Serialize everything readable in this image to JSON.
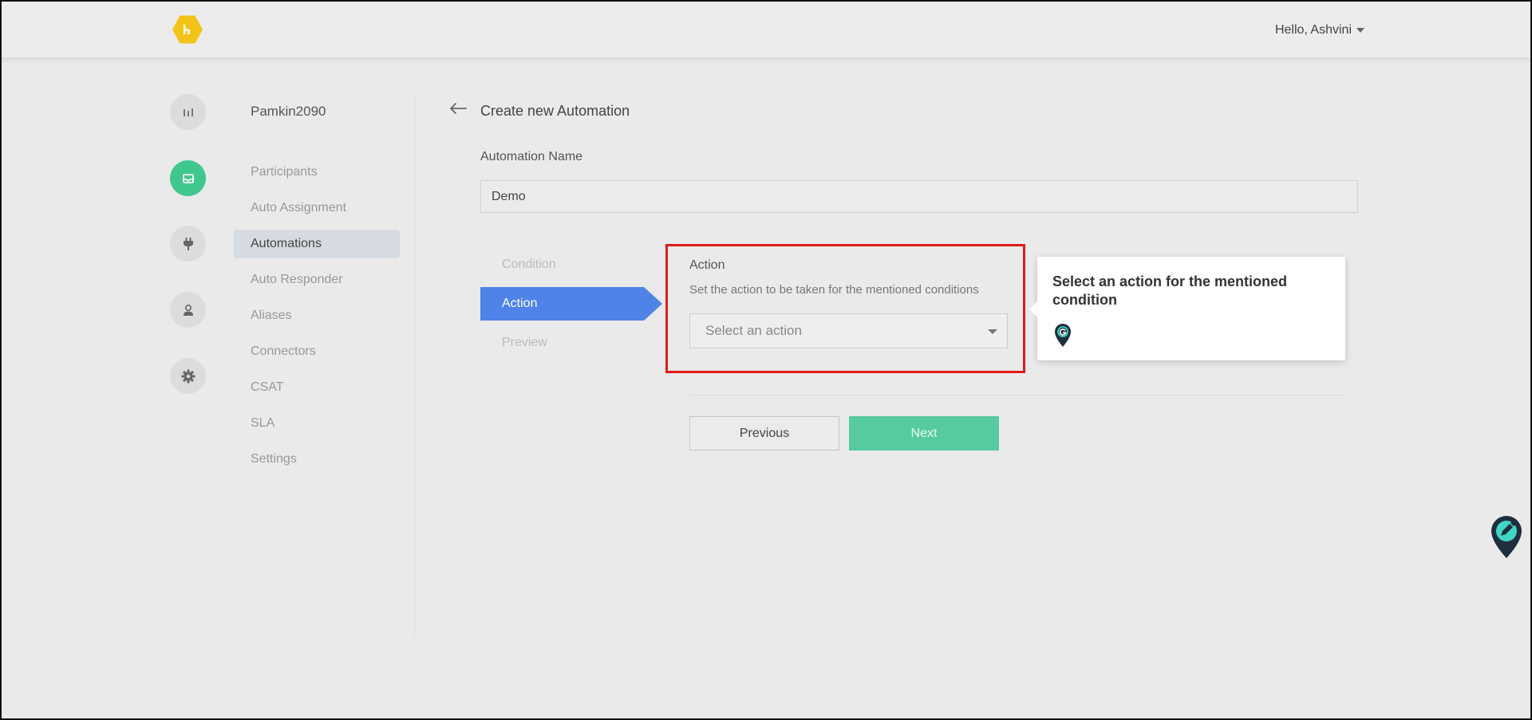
{
  "header": {
    "greeting": "Hello, Ashvini",
    "logo_icon": "hexagon-logo-icon",
    "accent_color": "#f2c419"
  },
  "rail": {
    "icons": [
      "analytics-icon",
      "inbox-icon",
      "plug-icon",
      "user-icon",
      "gear-icon"
    ],
    "active_color": "#3fc78e"
  },
  "sidebar": {
    "workspace": "Pamkin2090",
    "items": [
      {
        "label": "Participants"
      },
      {
        "label": "Auto Assignment"
      },
      {
        "label": "Automations",
        "active": true
      },
      {
        "label": "Auto Responder"
      },
      {
        "label": "Aliases"
      },
      {
        "label": "Connectors"
      },
      {
        "label": "CSAT"
      },
      {
        "label": "SLA"
      },
      {
        "label": "Settings"
      }
    ]
  },
  "main": {
    "title": "Create new Automation",
    "name_label": "Automation Name",
    "name_value": "Demo",
    "steps": [
      {
        "label": "Condition"
      },
      {
        "label": "Action",
        "active": true
      },
      {
        "label": "Preview"
      }
    ],
    "action": {
      "title": "Action",
      "description": "Set the action to be taken for the mentioned conditions",
      "select_placeholder": "Select an action"
    },
    "buttons": {
      "previous": "Previous",
      "next": "Next"
    },
    "step_color": "#4f83e8",
    "next_color": "#56cba0"
  },
  "tooltip": {
    "text": "Select an action for the mentioned condition",
    "icon": "guide-pin-icon"
  },
  "highlight_color": "#e01b1b"
}
